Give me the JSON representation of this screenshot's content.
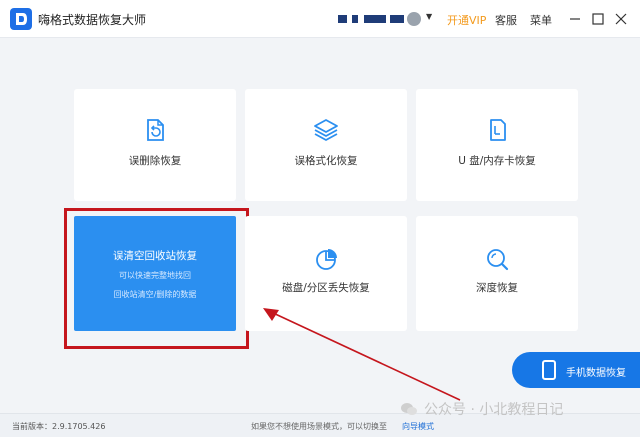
{
  "titlebar": {
    "app_title": "嗨格式数据恢复大师",
    "vip_label": "开通VIP",
    "support_label": "客服",
    "menu_label": "菜单"
  },
  "tiles": [
    {
      "label": "误删除恢复",
      "icon": "file-restore-icon"
    },
    {
      "label": "误格式化恢复",
      "icon": "layers-icon"
    },
    {
      "label": "U 盘/内存卡恢复",
      "icon": "sd-card-icon"
    },
    {
      "label": "磁盘/分区丢失恢复",
      "icon": "pie-chart-icon"
    },
    {
      "label": "深度恢复",
      "icon": "search-icon"
    }
  ],
  "active_tile": {
    "title": "误清空回收站恢复",
    "line1": "可以快速完整地找回",
    "line2": "回收站清空/删除的数据"
  },
  "phone_recovery": {
    "label": "手机数据恢复"
  },
  "footer": {
    "version_label": "当前版本：2.9.1705.426",
    "hint": "如果您不想使用场景模式，可以切换至",
    "guide_link": "向导模式"
  },
  "watermark": {
    "text": "公众号 · 小北教程日记"
  },
  "colors": {
    "accent": "#2b8ff0",
    "highlight": "#c5161d",
    "vip": "#f39a1d",
    "phone_button": "#1777e6"
  }
}
